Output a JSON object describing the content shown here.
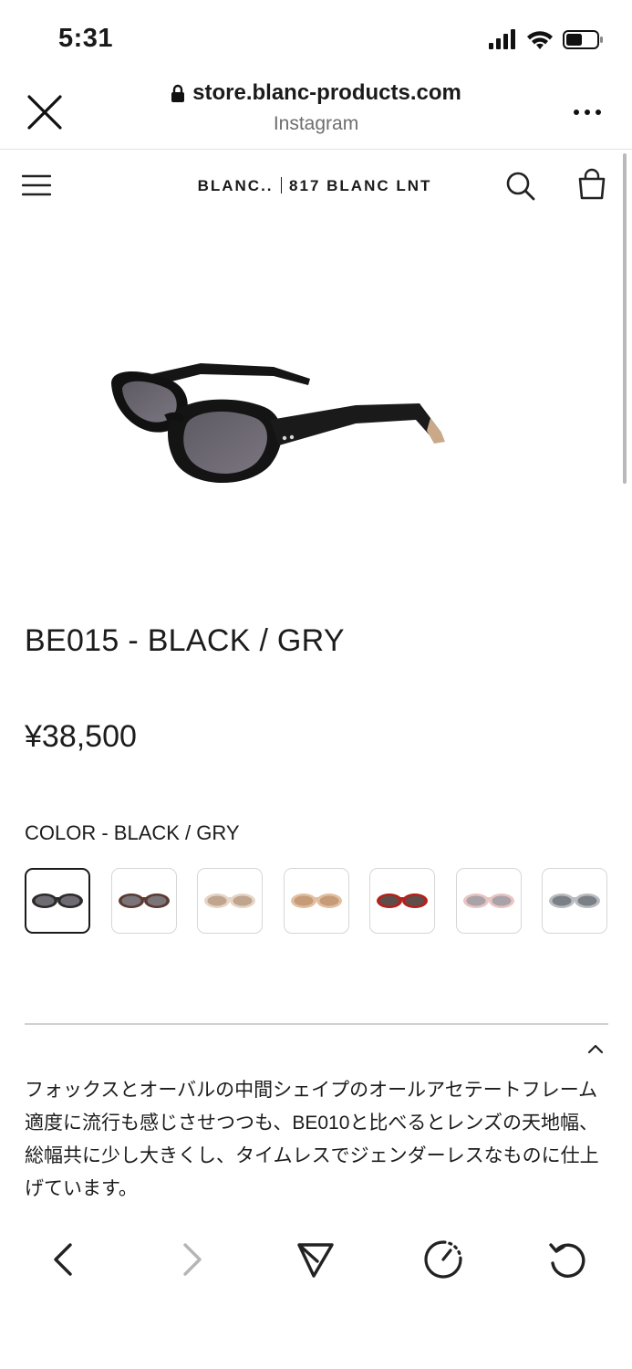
{
  "status_bar": {
    "time": "5:31"
  },
  "browser": {
    "domain": "store.blanc-products.com",
    "subtitle": "Instagram"
  },
  "store": {
    "brand_left": "BLANC..",
    "brand_right": "817 BLANC LNT"
  },
  "product": {
    "title": "BE015 - BLACK / GRY",
    "price": "¥38,500",
    "color_label": "COLOR - BLACK / GRY",
    "swatches": [
      {
        "name": "black-gry",
        "frame": "#2b2b2b",
        "lens": "#6f6b73",
        "selected": true
      },
      {
        "name": "brown-gry",
        "frame": "#5a3a32",
        "lens": "#7b7479"
      },
      {
        "name": "clear-beige",
        "frame": "#e6d4c6",
        "lens": "#bfa48e"
      },
      {
        "name": "beige-brown",
        "frame": "#e2bfa0",
        "lens": "#c69b78"
      },
      {
        "name": "red-gry",
        "frame": "#b5201c",
        "lens": "#5f4d49"
      },
      {
        "name": "pink-gry",
        "frame": "#e8c4c4",
        "lens": "#a9a2a6"
      },
      {
        "name": "clear-gry",
        "frame": "#b9bcc0",
        "lens": "#7b8087"
      }
    ],
    "description": [
      "フォックスとオーバルの中間シェイプのオールアセテートフレーム",
      "適度に流行も感じさせつつも、BE010と比べるとレンズの天地幅、総幅共に少し大きくし、タイムレスでジェンダーレスなものに仕上げています。"
    ]
  },
  "icons": {
    "close": "close-icon",
    "lock": "lock-icon",
    "more": "more-icon",
    "menu": "hamburger-menu-icon",
    "search": "search-icon",
    "cart": "shopping-bag-icon",
    "accordion": "chevron-up-icon",
    "back": "chevron-left-icon",
    "forward": "chevron-right-icon",
    "share": "send-icon",
    "speed": "gauge-icon",
    "reload": "reload-icon"
  }
}
